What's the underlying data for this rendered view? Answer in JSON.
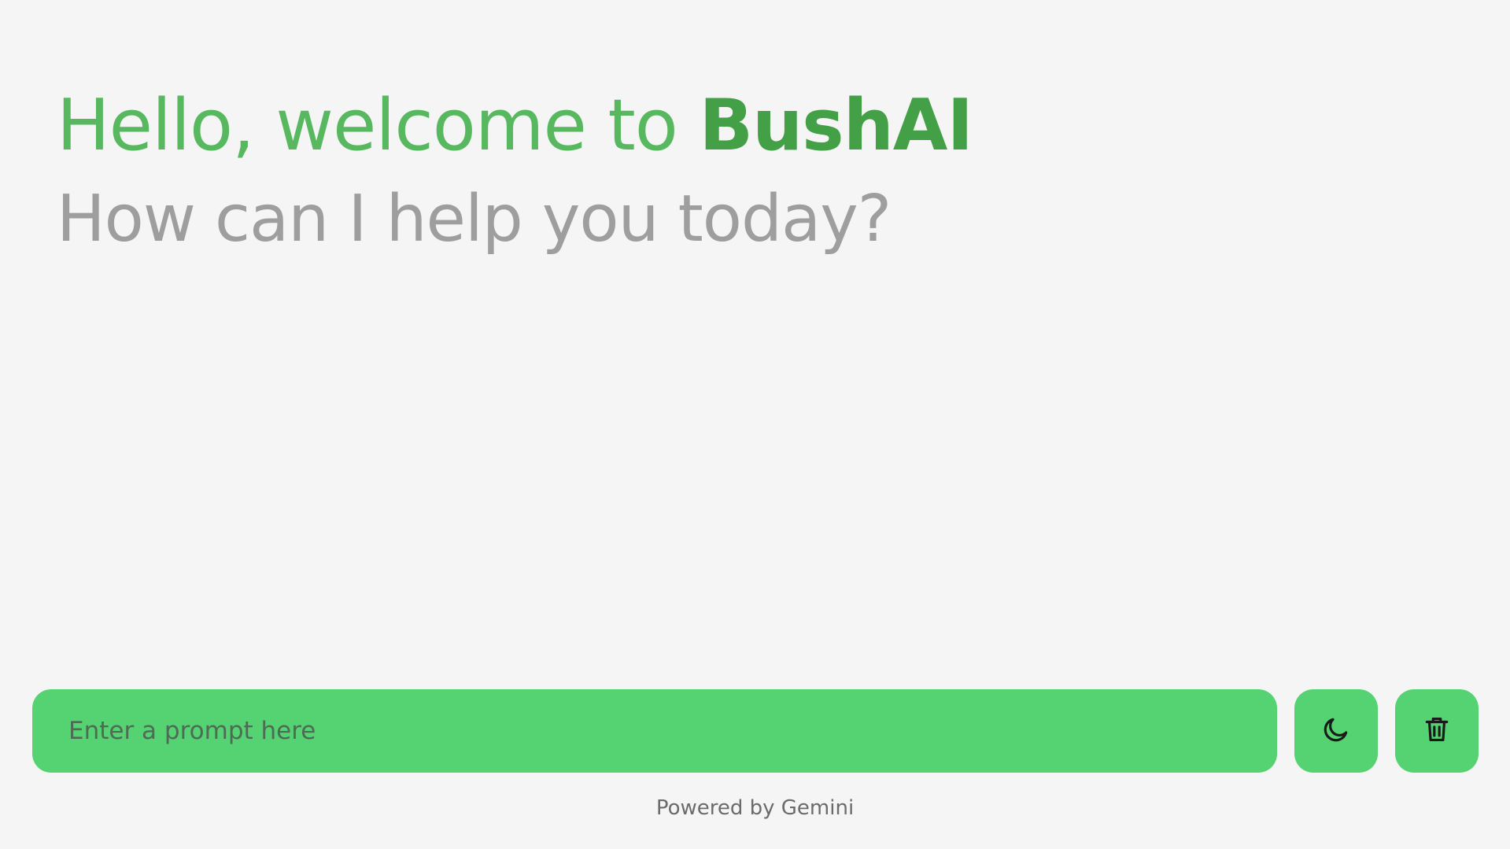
{
  "header": {
    "greeting_prefix": "Hello, welcome to ",
    "brand_name": "BushAI",
    "subtitle": "How can I help you today?"
  },
  "typing_area": {
    "placeholder": "Enter a prompt here",
    "value": "",
    "theme_toggle_icon": "moon-icon",
    "delete_chats_icon": "trash-icon"
  },
  "footer": {
    "text": "Powered by Gemini"
  },
  "colors": {
    "background": "#f5f5f5",
    "accent": "#55d271",
    "greeting": "#58b85f",
    "brand": "#43a047",
    "subtitle": "#9e9e9e",
    "footer_text": "#6b6b6b"
  }
}
